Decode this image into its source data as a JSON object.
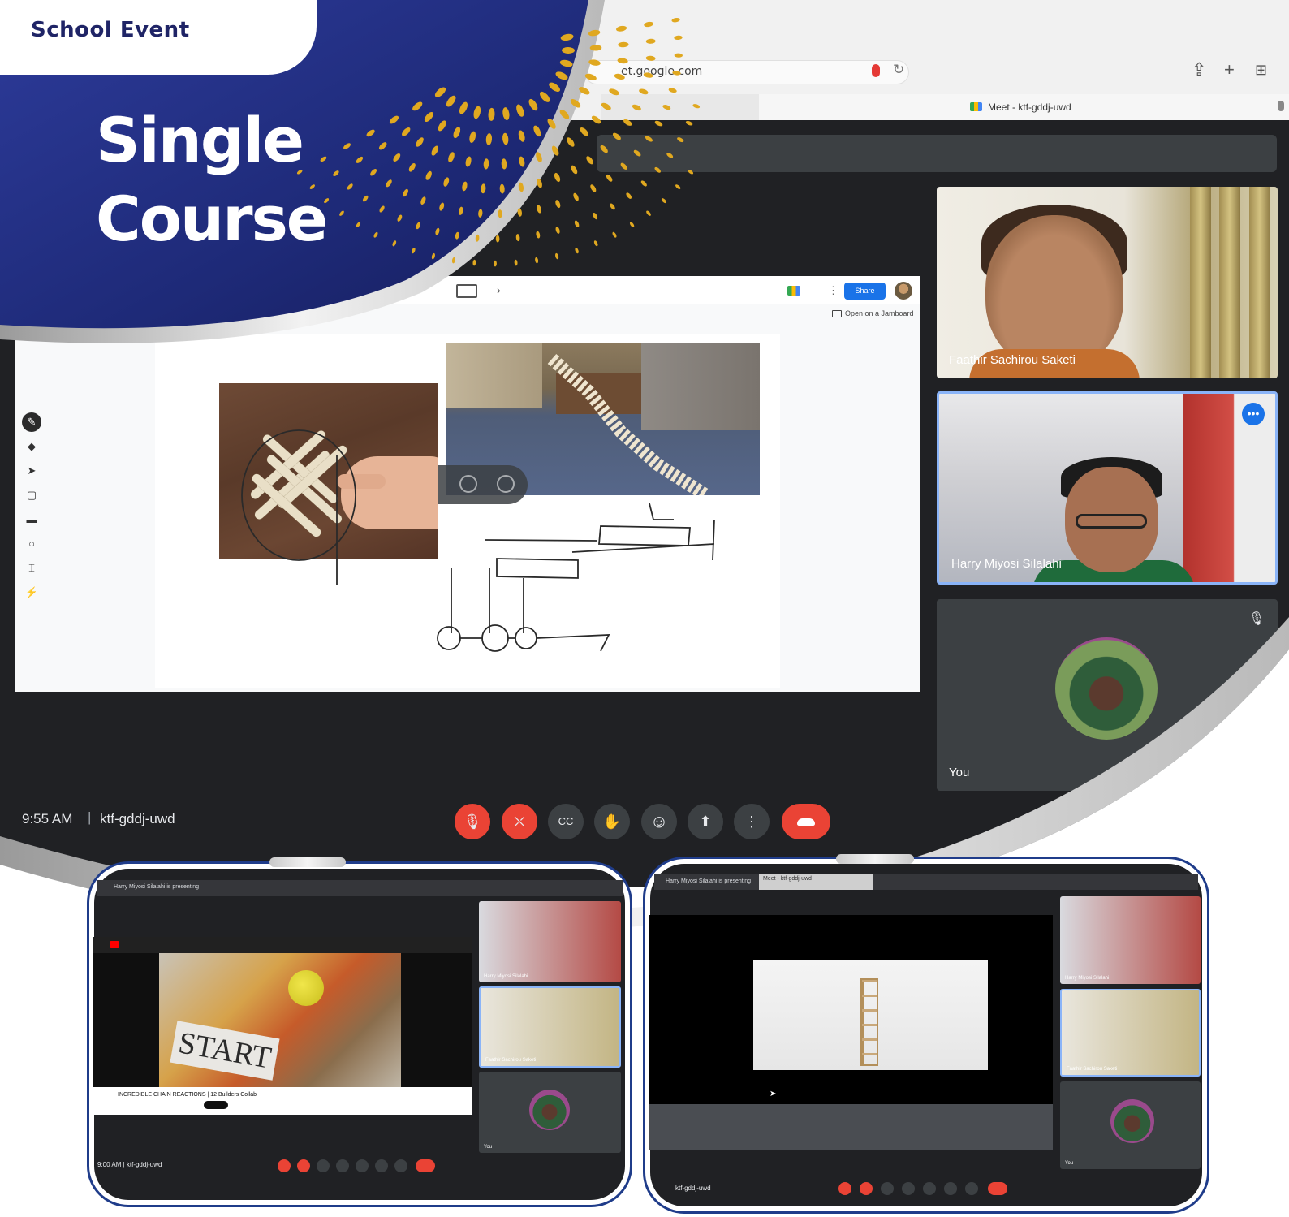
{
  "badge": {
    "label": "School Event"
  },
  "headline": {
    "line1": "Single",
    "line2": "Course"
  },
  "browser": {
    "url": "et.google.com",
    "tab_title": "Meet - ktf-gddj-uwd"
  },
  "presentation": {
    "share_label": "Share",
    "open_label": "Open on a Jamboard"
  },
  "participants": [
    {
      "name": "Faathir Sachirou Saketi"
    },
    {
      "name": "Harry Miyosi Silalahi"
    },
    {
      "name": "You"
    }
  ],
  "meeting": {
    "time": "9:55 AM",
    "separator": "|",
    "code": "ktf-gddj-uwd"
  },
  "controls": [
    {
      "icon": "mic-off-icon",
      "glyph": "🎙",
      "state": "red"
    },
    {
      "icon": "camera-off-icon",
      "glyph": "⛌",
      "state": "red"
    },
    {
      "icon": "captions-icon",
      "glyph": "CC",
      "state": "normal"
    },
    {
      "icon": "raise-hand-icon",
      "glyph": "✋",
      "state": "normal"
    },
    {
      "icon": "emoji-icon",
      "glyph": "☺",
      "state": "normal"
    },
    {
      "icon": "present-icon",
      "glyph": "⬆",
      "state": "normal"
    },
    {
      "icon": "more-options-icon",
      "glyph": "⋮",
      "state": "normal"
    }
  ],
  "thumb1": {
    "presenting": "Harry Miyosi Silalahi is presenting",
    "video_sign": "START",
    "video_title": "INCREDIBLE CHAIN REACTIONS | 12 Builders Collab",
    "tile1": "Harry Miyosi Silalahi",
    "tile2": "Faathir Sachirou Saketi",
    "you": "You",
    "meeting": "9:00 AM | ktf-gddj-uwd"
  },
  "thumb2": {
    "presenting": "Harry Miyosi Silalahi is presenting",
    "tab": "Meet - ktf-gddj-uwd",
    "tile1": "Harry Miyosi Silalahi",
    "tile2": "Faathir Sachirou Saketi",
    "you": "You",
    "meeting": "ktf-gddj-uwd"
  },
  "colors": {
    "navy": "#1f2466",
    "meet_bg": "#202124",
    "end_red": "#ea4335",
    "accent_blue": "#1a73e8",
    "gold": "#e0a820"
  }
}
